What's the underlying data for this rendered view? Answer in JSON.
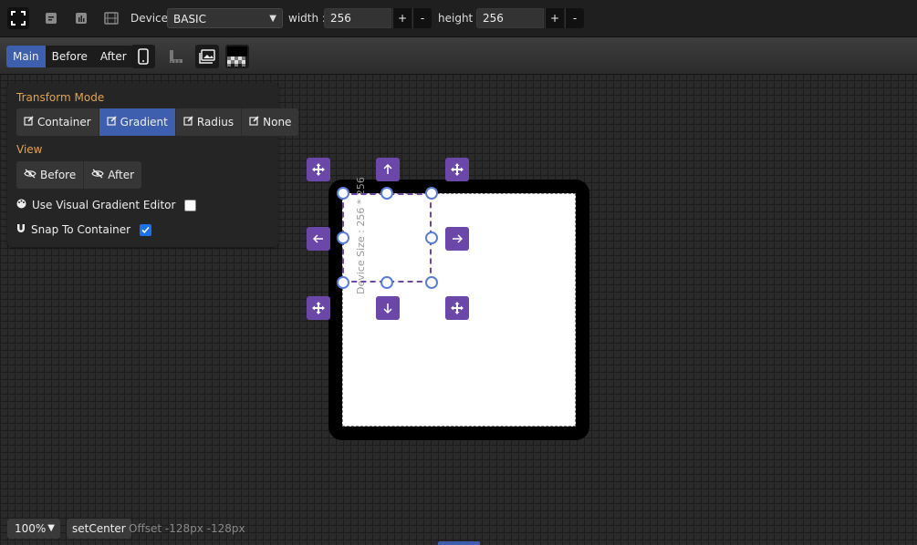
{
  "toolbar": {
    "device_label": "Device",
    "device_value": "BASIC",
    "width_label": "width :",
    "width_value": "256",
    "height_label": "height :",
    "height_value": "256",
    "plus": "+",
    "minus": "-",
    "icons": [
      "fullscreen-icon",
      "document-icon",
      "chart-icon",
      "film-icon"
    ]
  },
  "subbar": {
    "tabs": [
      {
        "label": "Main",
        "active": true
      },
      {
        "label": "Before",
        "active": false
      },
      {
        "label": "After",
        "active": false
      }
    ],
    "icons": [
      "mobile-icon",
      "ruler-icon",
      "image-icon",
      "checker-icon"
    ]
  },
  "panel": {
    "transform_title": "Transform Mode",
    "transform_buttons": [
      {
        "label": "Container",
        "active": false
      },
      {
        "label": "Gradient",
        "active": true
      },
      {
        "label": "Radius",
        "active": false
      },
      {
        "label": "None",
        "active": false
      }
    ],
    "view_title": "View",
    "view_buttons": [
      {
        "label": "Before"
      },
      {
        "label": "After"
      }
    ],
    "visual_gradient_label": "Use Visual Gradient Editor",
    "visual_gradient_checked": false,
    "snap_label": "Snap To Container",
    "snap_checked": true
  },
  "canvas": {
    "size_label": "Device Size : 256 * 256"
  },
  "bottom": {
    "zoom": "100%",
    "set_center": "setCenter",
    "offset": "Offset -128px -128px"
  },
  "colors": {
    "accent": "#3e5fae",
    "purple": "#6a47a8",
    "section_title": "#e3a34f"
  }
}
